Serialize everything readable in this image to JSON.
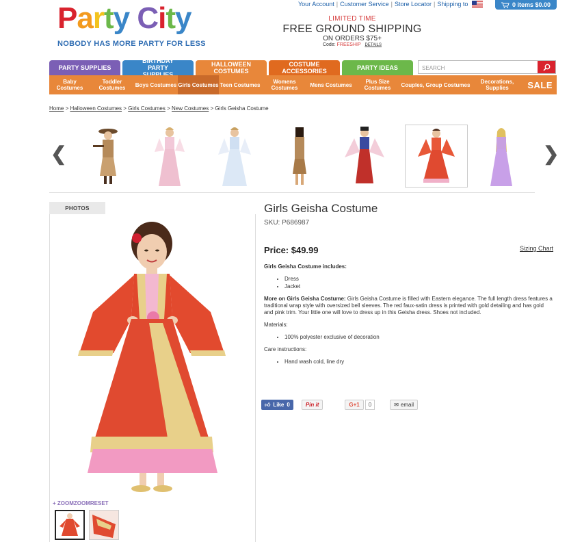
{
  "header": {
    "logo_text": "Party City",
    "tagline": "NOBODY HAS MORE PARTY FOR LESS",
    "top_links": [
      "Your Account",
      "Customer Service",
      "Store Locator",
      "Shipping to"
    ],
    "cart_label": "0 items $0.00"
  },
  "promo": {
    "limited": "LIMITED TIME",
    "headline": "FREE GROUND SHIPPING",
    "orders": "ON ORDERS $75+",
    "code_label": "Code:",
    "code_value": "FREESHIP",
    "details": "DETAILS"
  },
  "nav": {
    "tabs": [
      {
        "label": "PARTY SUPPLIES",
        "color": "#7b5fb5"
      },
      {
        "label": "BIRTHDAY PARTY SUPPLIES",
        "color": "#3a86c8"
      },
      {
        "label": "HALLOWEEN COSTUMES",
        "color": "#e8873a"
      },
      {
        "label": "COSTUME ACCESSORIES",
        "color": "#e06a1f"
      },
      {
        "label": "PARTY IDEAS",
        "color": "#6cb84a"
      }
    ],
    "search_placeholder": "SEARCH",
    "subnav": [
      "Baby Costumes",
      "Toddler Costumes",
      "Boys Costumes",
      "Girls Costumes",
      "Teen Costumes",
      "Womens Costumes",
      "Mens Costumes",
      "Plus Size Costumes",
      "Couples, Group Costumes",
      "Decorations, Supplies"
    ],
    "sale": "SALE"
  },
  "breadcrumb": {
    "items": [
      "Home",
      "Halloween Costumes",
      "Girls Costumes",
      "New Costumes"
    ],
    "current": "Girls Geisha Costume"
  },
  "gallery": {
    "photos_tab": "PHOTOS",
    "zoom_label": "+ ZOOMZOOMRESET"
  },
  "product": {
    "title": "Girls Geisha Costume",
    "sku": "SKU: P686987",
    "price": "Price: $49.99",
    "sizing_chart": "Sizing Chart",
    "includes_heading": "Girls Geisha Costume includes:",
    "includes": [
      "Dress",
      "Jacket"
    ],
    "more_heading": "More on Girls Geisha Costume:",
    "more_text": " Girls Geisha Costume is filled with Eastern elegance. The full length dress features a traditional wrap style with oversized bell sleeves. The red faux-satin dress is printed with gold detailing and has gold and pink trim. Your little one will love to dress up in this Geisha dress. Shoes not included.",
    "materials_heading": "Materials:",
    "materials": [
      "100% polyester exclusive of decoration"
    ],
    "care_heading": "Care instructions:",
    "care": [
      "Hand wash cold, line dry"
    ]
  },
  "social": {
    "like": "Like",
    "like_count": "0",
    "pin": "Pin it",
    "gplus": "G+1",
    "gplus_count": "0",
    "email": "email"
  }
}
